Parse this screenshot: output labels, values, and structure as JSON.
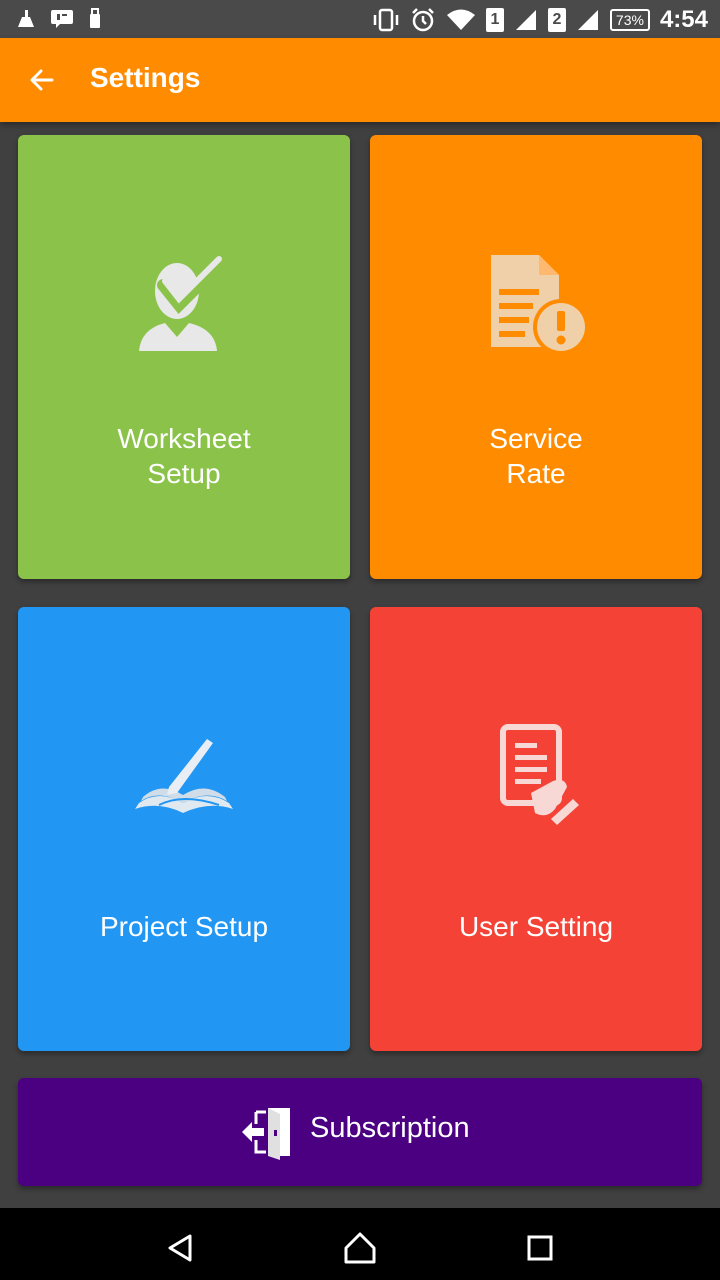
{
  "status_bar": {
    "sim1": "1",
    "sim2": "2",
    "battery": "73%",
    "time": "4:54"
  },
  "app_bar": {
    "title": "Settings"
  },
  "tiles": {
    "worksheet": {
      "line1": "Worksheet",
      "line2": "Setup",
      "color": "#8bc34a"
    },
    "service": {
      "line1": "Service",
      "line2": "Rate",
      "color": "#ff8c00"
    },
    "project": {
      "label": "Project Setup",
      "color": "#2196f3"
    },
    "user": {
      "label": "User Setting",
      "color": "#f44336"
    }
  },
  "subscription": {
    "label": "Subscription",
    "color": "#4b0082"
  },
  "icons": {
    "back": "arrow-back-icon",
    "worksheet": "person-check-icon",
    "service": "document-alert-icon",
    "project": "book-pen-icon",
    "user": "document-hand-icon",
    "subscription": "exit-door-icon"
  }
}
